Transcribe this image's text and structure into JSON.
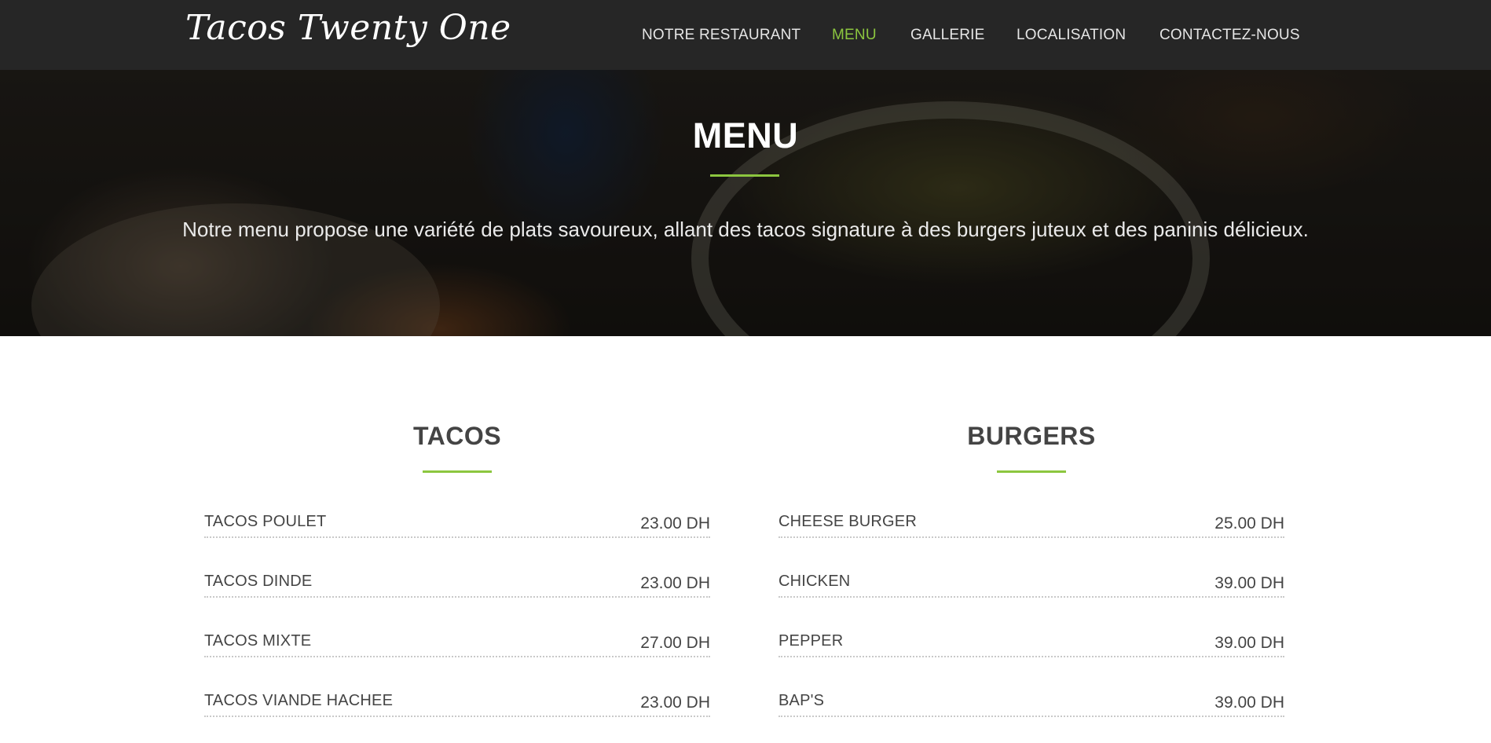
{
  "navbar": {
    "brand": "Tacos Twenty One",
    "links": [
      {
        "label": "NOTRE RESTAURANT",
        "active": false
      },
      {
        "label": "MENU",
        "active": true
      },
      {
        "label": "GALLERIE",
        "active": false
      },
      {
        "label": "LOCALISATION",
        "active": false
      },
      {
        "label": "CONTACTEZ-NOUS",
        "active": false
      }
    ]
  },
  "hero": {
    "title": "MENU",
    "subtitle": "Notre menu propose une variété de plats savoureux, allant des tacos signature à des burgers juteux et des paninis délicieux."
  },
  "sections": [
    {
      "title": "TACOS",
      "items": [
        {
          "name": "TACOS POULET",
          "price": "23.00 DH"
        },
        {
          "name": "TACOS DINDE",
          "price": "23.00 DH"
        },
        {
          "name": "TACOS MIXTE",
          "price": "27.00 DH"
        },
        {
          "name": "TACOS VIANDE HACHEE",
          "price": "23.00 DH"
        }
      ]
    },
    {
      "title": "BURGERS",
      "items": [
        {
          "name": "CHEESE BURGER",
          "price": "25.00 DH"
        },
        {
          "name": "CHICKEN",
          "price": "39.00 DH"
        },
        {
          "name": "PEPPER",
          "price": "39.00 DH"
        },
        {
          "name": "BAP'S",
          "price": "39.00 DH"
        }
      ]
    }
  ],
  "colors": {
    "navbar_bg": "#262626",
    "accent": "#8cc63f",
    "text": "#444444"
  }
}
